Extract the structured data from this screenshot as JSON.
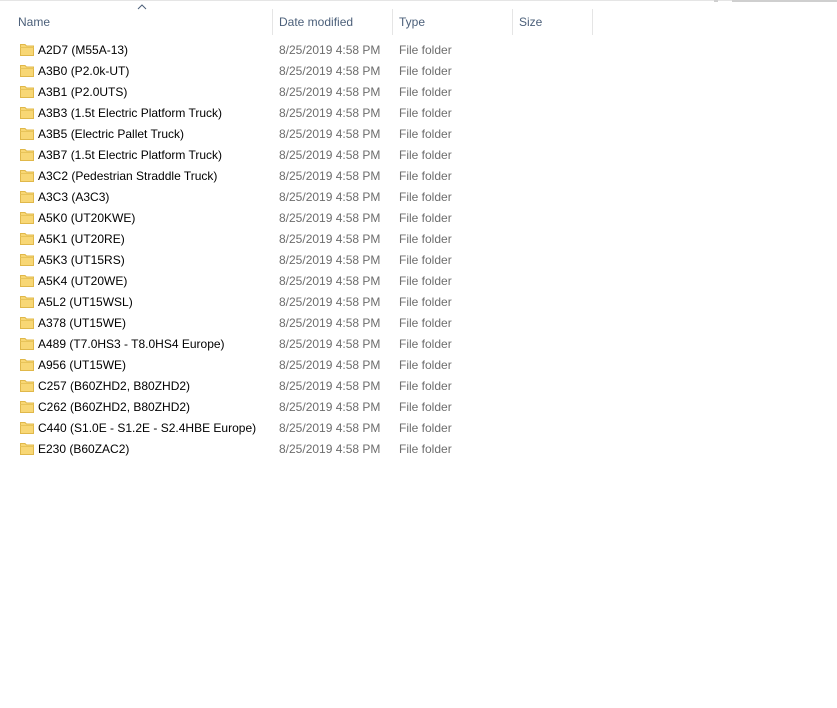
{
  "columns": {
    "name": "Name",
    "date": "Date modified",
    "type": "Type",
    "size": "Size"
  },
  "sort": {
    "column": "name",
    "direction": "ascending",
    "icon": "chevron-up-icon"
  },
  "folder_icon_color": "#f8d775",
  "files": [
    {
      "name": "A2D7 (M55A-13)",
      "date": "8/25/2019 4:58 PM",
      "type": "File folder",
      "size": ""
    },
    {
      "name": "A3B0 (P2.0k-UT)",
      "date": "8/25/2019 4:58 PM",
      "type": "File folder",
      "size": ""
    },
    {
      "name": "A3B1 (P2.0UTS)",
      "date": "8/25/2019 4:58 PM",
      "type": "File folder",
      "size": ""
    },
    {
      "name": "A3B3 (1.5t Electric Platform Truck)",
      "date": "8/25/2019 4:58 PM",
      "type": "File folder",
      "size": ""
    },
    {
      "name": "A3B5 (Electric Pallet Truck)",
      "date": "8/25/2019 4:58 PM",
      "type": "File folder",
      "size": ""
    },
    {
      "name": "A3B7 (1.5t Electric Platform Truck)",
      "date": "8/25/2019 4:58 PM",
      "type": "File folder",
      "size": ""
    },
    {
      "name": "A3C2 (Pedestrian Straddle Truck)",
      "date": "8/25/2019 4:58 PM",
      "type": "File folder",
      "size": ""
    },
    {
      "name": "A3C3 (A3C3)",
      "date": "8/25/2019 4:58 PM",
      "type": "File folder",
      "size": ""
    },
    {
      "name": "A5K0 (UT20KWE)",
      "date": "8/25/2019 4:58 PM",
      "type": "File folder",
      "size": ""
    },
    {
      "name": "A5K1 (UT20RE)",
      "date": "8/25/2019 4:58 PM",
      "type": "File folder",
      "size": ""
    },
    {
      "name": "A5K3 (UT15RS)",
      "date": "8/25/2019 4:58 PM",
      "type": "File folder",
      "size": ""
    },
    {
      "name": "A5K4 (UT20WE)",
      "date": "8/25/2019 4:58 PM",
      "type": "File folder",
      "size": ""
    },
    {
      "name": "A5L2 (UT15WSL)",
      "date": "8/25/2019 4:58 PM",
      "type": "File folder",
      "size": ""
    },
    {
      "name": "A378 (UT15WE)",
      "date": "8/25/2019 4:58 PM",
      "type": "File folder",
      "size": ""
    },
    {
      "name": "A489 (T7.0HS3 - T8.0HS4 Europe)",
      "date": "8/25/2019 4:58 PM",
      "type": "File folder",
      "size": ""
    },
    {
      "name": "A956 (UT15WE)",
      "date": "8/25/2019 4:58 PM",
      "type": "File folder",
      "size": ""
    },
    {
      "name": "C257 (B60ZHD2, B80ZHD2)",
      "date": "8/25/2019 4:58 PM",
      "type": "File folder",
      "size": ""
    },
    {
      "name": "C262 (B60ZHD2, B80ZHD2)",
      "date": "8/25/2019 4:58 PM",
      "type": "File folder",
      "size": ""
    },
    {
      "name": "C440 (S1.0E - S1.2E - S2.4HBE Europe)",
      "date": "8/25/2019 4:58 PM",
      "type": "File folder",
      "size": ""
    },
    {
      "name": "E230 (B60ZAC2)",
      "date": "8/25/2019 4:58 PM",
      "type": "File folder",
      "size": ""
    }
  ]
}
